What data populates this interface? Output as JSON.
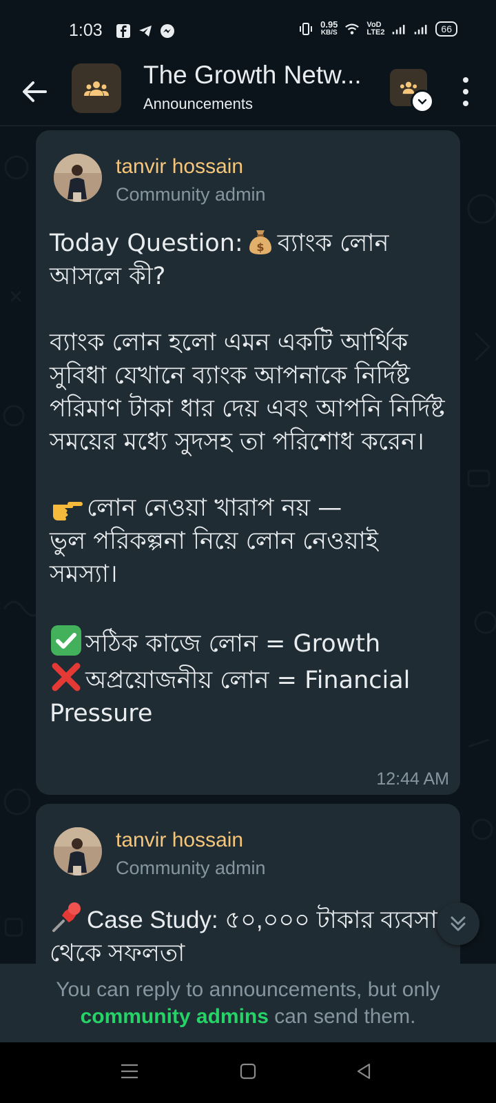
{
  "status_bar": {
    "time": "1:03",
    "net_speed_value": "0.95",
    "net_speed_unit": "KB/S",
    "volte": "VoD LTE2",
    "battery": "66"
  },
  "header": {
    "title": "The Growth Netw...",
    "subtitle": "Announcements"
  },
  "messages": [
    {
      "author": "tanvir hossain",
      "role": "Community admin",
      "line_question_prefix": "Today Question:",
      "line_question_rest": "ব্যাংক লোন আসলে কী?",
      "paragraph_1": "ব্যাংক লোন হলো এমন একটি আর্থিক সুবিধা যেখানে ব্যাংক আপনাকে নির্দিষ্ট পরিমাণ টাকা ধার দেয় এবং আপনি নির্দিষ্ট সময়ের মধ্যে সুদসহ তা পরিশোধ করেন।",
      "point_line_1": "লোন নেওয়া খারাপ নয় —",
      "point_line_2": "ভুল পরিকল্পনা নিয়ে লোন নেওয়াই সমস্যা।",
      "good_line": "সঠিক কাজে লোন = Growth",
      "bad_line": "অপ্রয়োজনীয় লোন = Financial Pressure",
      "time": "12:44 AM"
    },
    {
      "author": "tanvir hossain",
      "role": "Community admin",
      "line_1": "Case Study: ৫০,০০০ টাকার ব্যবসা",
      "line_2": "থেকে সফলতা"
    }
  ],
  "footer": {
    "note_prefix": "You can reply to announcements, but only",
    "note_highlight": "community admins",
    "note_suffix": "can send them."
  },
  "colors": {
    "background": "#0b141a",
    "bubble": "#202c33",
    "author": "#f6c67a",
    "muted": "#8696a0",
    "accent_green": "#25d366"
  }
}
